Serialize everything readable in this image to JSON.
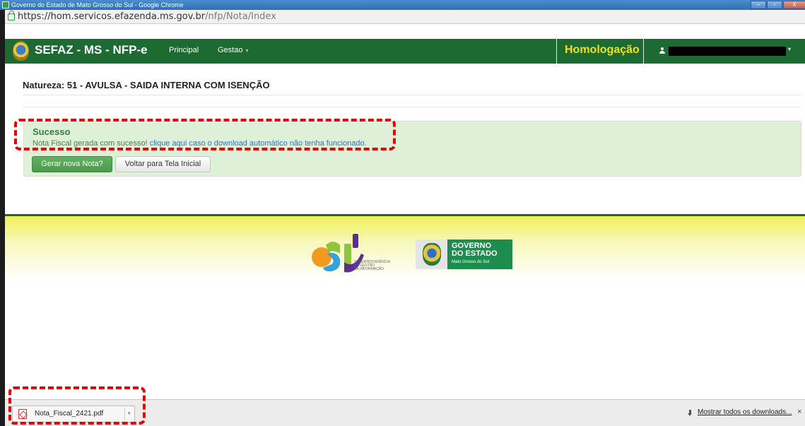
{
  "window": {
    "title": "Governo do Estado de Mato Grosso do Sul - Google Chrome",
    "btn_min": "–",
    "btn_max": "▫",
    "btn_close": "X"
  },
  "address": {
    "url_host": "https://hom.servicos.efazenda.ms.gov.br",
    "url_path": "/nfp/Nota/Index"
  },
  "navbar": {
    "brand": "SEFAZ - MS - NFP-e",
    "items": [
      "Principal",
      "Gestao"
    ],
    "environment": "Homologação",
    "user_caret": "▾",
    "colors": {
      "bar": "#1d6b33",
      "environment": "#f3e01a"
    }
  },
  "page": {
    "heading": "Natureza: 51 - AVULSA - SAIDA INTERNA COM ISENÇÃO"
  },
  "alert": {
    "title": "Sucesso",
    "message": "Nota Fiscal gerada com sucesso! ",
    "link": "clique aqui caso o download automático não tenha funcionado."
  },
  "buttons": {
    "new_note": "Gerar nova Nota?",
    "back_home": "Voltar para Tela Inicial"
  },
  "footer": {
    "sgi_lines": [
      "SUPERINTENDÊNCIA",
      "DE GESTÃO",
      "DA INFORMAÇÃO"
    ],
    "gov_line1": "GOVERNO",
    "gov_line2": "DO ESTADO",
    "gov_line3": "Mato Grosso do Sul"
  },
  "downloads": {
    "file": "Nota_Fiscal_2421.pdf",
    "caret": "▾",
    "show_all": "Mostrar todos os downloads...",
    "close": "×"
  }
}
